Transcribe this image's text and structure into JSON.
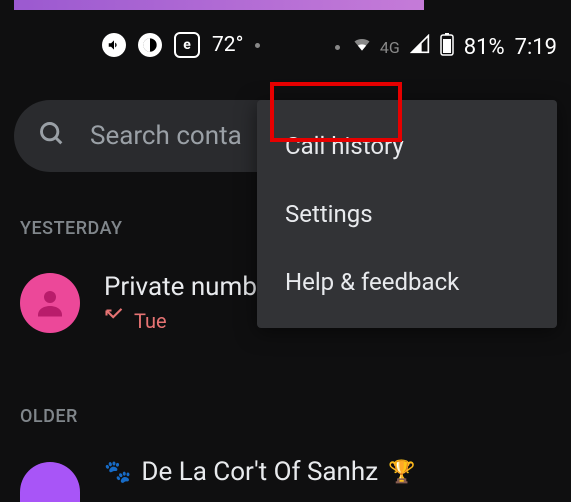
{
  "status": {
    "temp": "72°",
    "net_label": "4G",
    "battery": "81%",
    "time": "7:19"
  },
  "search": {
    "placeholder": "Search conta"
  },
  "sections": {
    "yesterday": "YESTERDAY",
    "older": "OLDER"
  },
  "contacts": [
    {
      "name": "Private numb",
      "day": "Tue"
    },
    {
      "name": "De La Cor't Of Sanhz"
    }
  ],
  "menu": {
    "items": [
      "Call history",
      "Settings",
      "Help & feedback"
    ]
  }
}
